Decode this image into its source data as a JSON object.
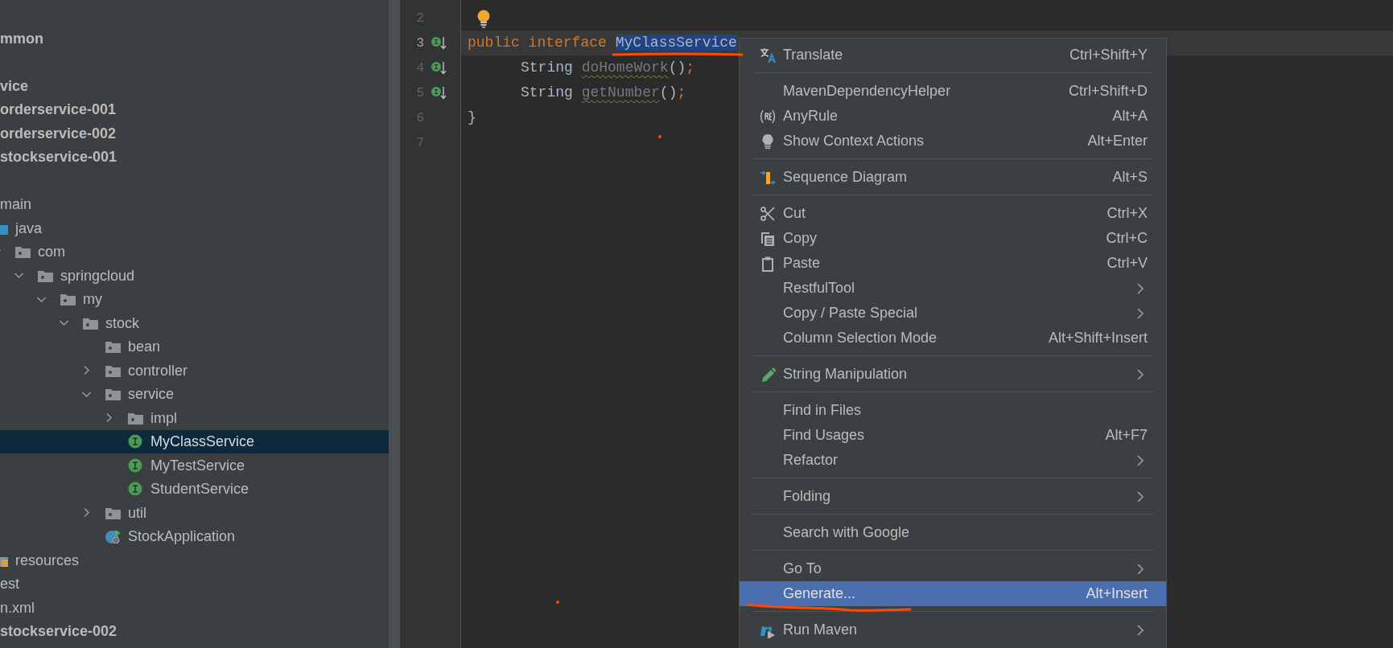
{
  "project_tree": [
    {
      "label": "mmon",
      "kind": "module",
      "selected": false
    },
    {
      "label": "vice",
      "kind": "module",
      "selected": false,
      "gap_before": true,
      "children": [
        {
          "label": "orderservice-001",
          "kind": "module",
          "selected": false
        },
        {
          "label": "orderservice-002",
          "kind": "module",
          "selected": false
        },
        {
          "label": "stockservice-001",
          "kind": "module",
          "selected": false,
          "children": [
            {
              "label": "main",
              "selected": false,
              "gap_before": true,
              "children": [
                {
                  "label": "java",
                  "kind": "source",
                  "selected": false,
                  "children": [
                    {
                      "label": "com",
                      "kind": "package",
                      "selected": false,
                      "expanded": true,
                      "children": [
                        {
                          "label": "springcloud",
                          "kind": "package",
                          "selected": false,
                          "expanded": true,
                          "children": [
                            {
                              "label": "my",
                              "kind": "package",
                              "selected": false,
                              "expanded": true,
                              "children": [
                                {
                                  "label": "stock",
                                  "kind": "package",
                                  "selected": false,
                                  "expanded": true,
                                  "children": [
                                    {
                                      "label": "bean",
                                      "kind": "package",
                                      "selected": false
                                    },
                                    {
                                      "label": "controller",
                                      "kind": "package",
                                      "selected": false,
                                      "expanded": false
                                    },
                                    {
                                      "label": "service",
                                      "kind": "package",
                                      "selected": false,
                                      "expanded": true,
                                      "children": [
                                        {
                                          "label": "impl",
                                          "kind": "package",
                                          "selected": false,
                                          "expanded": false
                                        },
                                        {
                                          "label": "MyClassService",
                                          "kind": "interface",
                                          "selected": true
                                        },
                                        {
                                          "label": "MyTestService",
                                          "kind": "interface",
                                          "selected": false
                                        },
                                        {
                                          "label": "StudentService",
                                          "kind": "interface",
                                          "selected": false
                                        }
                                      ]
                                    },
                                    {
                                      "label": "util",
                                      "kind": "package",
                                      "selected": false,
                                      "expanded": false
                                    },
                                    {
                                      "label": "StockApplication",
                                      "kind": "app",
                                      "selected": false
                                    }
                                  ]
                                }
                              ]
                            }
                          ]
                        }
                      ]
                    }
                  ]
                },
                {
                  "label": "resources",
                  "kind": "resources",
                  "selected": false
                }
              ]
            },
            {
              "label": "est",
              "selected": false
            },
            {
              "label": "n.xml",
              "selected": false
            }
          ]
        },
        {
          "label": "stockservice-002",
          "kind": "module",
          "selected": false
        }
      ]
    }
  ],
  "editor": {
    "lines": [
      {
        "number": "2",
        "bulb": true
      },
      {
        "number": "3",
        "current": true,
        "implemented": true,
        "tokens": [
          {
            "text": "public interface ",
            "kind": "keyword"
          },
          {
            "text": "MyClassService",
            "kind": "plain",
            "selected": true
          }
        ]
      },
      {
        "number": "4",
        "implemented": true,
        "indented": true,
        "tokens": [
          {
            "text": "String ",
            "kind": "plain"
          },
          {
            "text": "doHomeWork",
            "kind": "unused"
          },
          {
            "text": "()",
            "kind": "plain"
          },
          {
            "text": ";",
            "kind": "keyword"
          }
        ]
      },
      {
        "number": "5",
        "implemented": true,
        "indented": true,
        "tokens": [
          {
            "text": "String ",
            "kind": "plain"
          },
          {
            "text": "getNumber",
            "kind": "unused"
          },
          {
            "text": "()",
            "kind": "plain"
          },
          {
            "text": ";",
            "kind": "keyword"
          }
        ]
      },
      {
        "number": "6",
        "tokens": [
          {
            "text": "}",
            "kind": "plain"
          }
        ]
      },
      {
        "number": "7"
      }
    ]
  },
  "context_menu": [
    {
      "kind": "item",
      "label": "Translate",
      "shortcut": "Ctrl+Shift+Y",
      "submenu": false,
      "selected": false
    },
    {
      "kind": "separator"
    },
    {
      "kind": "item",
      "label": "MavenDependencyHelper",
      "shortcut": "Ctrl+Shift+D",
      "submenu": false,
      "selected": false
    },
    {
      "kind": "item",
      "label": "AnyRule",
      "shortcut": "Alt+A",
      "submenu": false,
      "selected": false
    },
    {
      "kind": "item",
      "label": "Show Context Actions",
      "shortcut": "Alt+Enter",
      "submenu": false,
      "selected": false
    },
    {
      "kind": "separator"
    },
    {
      "kind": "item",
      "label": "Sequence Diagram",
      "shortcut": "Alt+S",
      "submenu": false,
      "selected": false
    },
    {
      "kind": "separator"
    },
    {
      "kind": "item",
      "label": "Cut",
      "shortcut": "Ctrl+X",
      "submenu": false,
      "selected": false
    },
    {
      "kind": "item",
      "label": "Copy",
      "shortcut": "Ctrl+C",
      "submenu": false,
      "selected": false
    },
    {
      "kind": "item",
      "label": "Paste",
      "shortcut": "Ctrl+V",
      "submenu": false,
      "selected": false
    },
    {
      "kind": "item",
      "label": "RestfulTool",
      "submenu": true,
      "selected": false
    },
    {
      "kind": "item",
      "label": "Copy / Paste Special",
      "submenu": true,
      "selected": false
    },
    {
      "kind": "item",
      "label": "Column Selection Mode",
      "shortcut": "Alt+Shift+Insert",
      "submenu": false,
      "selected": false
    },
    {
      "kind": "separator"
    },
    {
      "kind": "item",
      "label": "String Manipulation",
      "submenu": true,
      "selected": false
    },
    {
      "kind": "separator"
    },
    {
      "kind": "item",
      "label": "Find in Files",
      "submenu": false,
      "selected": false
    },
    {
      "kind": "item",
      "label": "Find Usages",
      "shortcut": "Alt+F7",
      "submenu": false,
      "selected": false
    },
    {
      "kind": "item",
      "label": "Refactor",
      "submenu": true,
      "selected": false
    },
    {
      "kind": "separator"
    },
    {
      "kind": "item",
      "label": "Folding",
      "submenu": true,
      "selected": false
    },
    {
      "kind": "separator"
    },
    {
      "kind": "item",
      "label": "Search with Google",
      "submenu": false,
      "selected": false
    },
    {
      "kind": "separator"
    },
    {
      "kind": "item",
      "label": "Go To",
      "submenu": true,
      "selected": false
    },
    {
      "kind": "item",
      "label": "Generate...",
      "shortcut": "Alt+Insert",
      "submenu": false,
      "selected": true
    },
    {
      "kind": "separator"
    },
    {
      "kind": "item",
      "label": "Run Maven",
      "submenu": true,
      "selected": false
    }
  ],
  "annotations": [
    {
      "kind": "stroke"
    },
    {
      "kind": "stroke"
    },
    {
      "kind": "dot"
    },
    {
      "kind": "dot"
    }
  ]
}
